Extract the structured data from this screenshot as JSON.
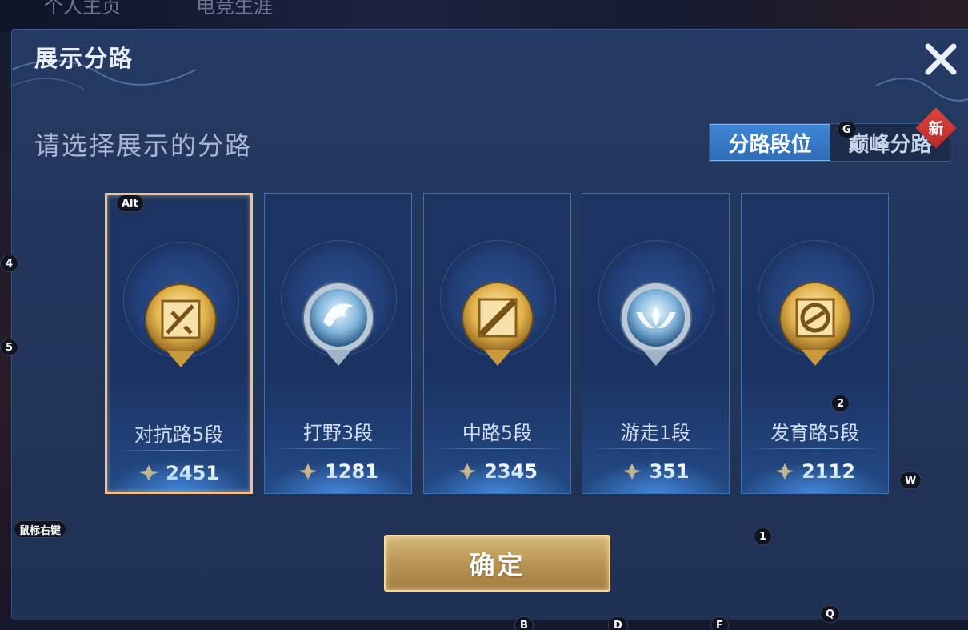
{
  "background": {
    "text_1": "个人主页",
    "text_2": "电竞生涯"
  },
  "dialog": {
    "title": "展示分路",
    "subtitle": "请选择展示的分路",
    "close_icon": "close-icon",
    "tabs": [
      {
        "label": "分路段位",
        "active": true
      },
      {
        "label": "巅峰分路",
        "active": false
      }
    ],
    "new_badge": "新",
    "cards": [
      {
        "rank": "对抗路5段",
        "score": "2451",
        "emblem": "clash-lane-gold-icon",
        "selected": true
      },
      {
        "rank": "打野3段",
        "score": "1281",
        "emblem": "jungle-silver-icon",
        "selected": false
      },
      {
        "rank": "中路5段",
        "score": "2345",
        "emblem": "mid-lane-gold-icon",
        "selected": false
      },
      {
        "rank": "游走1段",
        "score": "351",
        "emblem": "roam-silver-icon",
        "selected": false
      },
      {
        "rank": "发育路5段",
        "score": "2112",
        "emblem": "farm-lane-gold-icon",
        "selected": false
      }
    ],
    "confirm_label": "确定"
  },
  "hotkeys": {
    "alt": "Alt",
    "g": "G",
    "four": "4",
    "five": "5",
    "two": "2",
    "w": "W",
    "right_click": "鼠标右键",
    "one": "1",
    "q": "Q",
    "b": "B",
    "d": "D",
    "f": "F"
  },
  "colors": {
    "gold_accent": "#f3c08e",
    "tab_active": "#3f86d4",
    "panel_bg": "#22365b"
  }
}
